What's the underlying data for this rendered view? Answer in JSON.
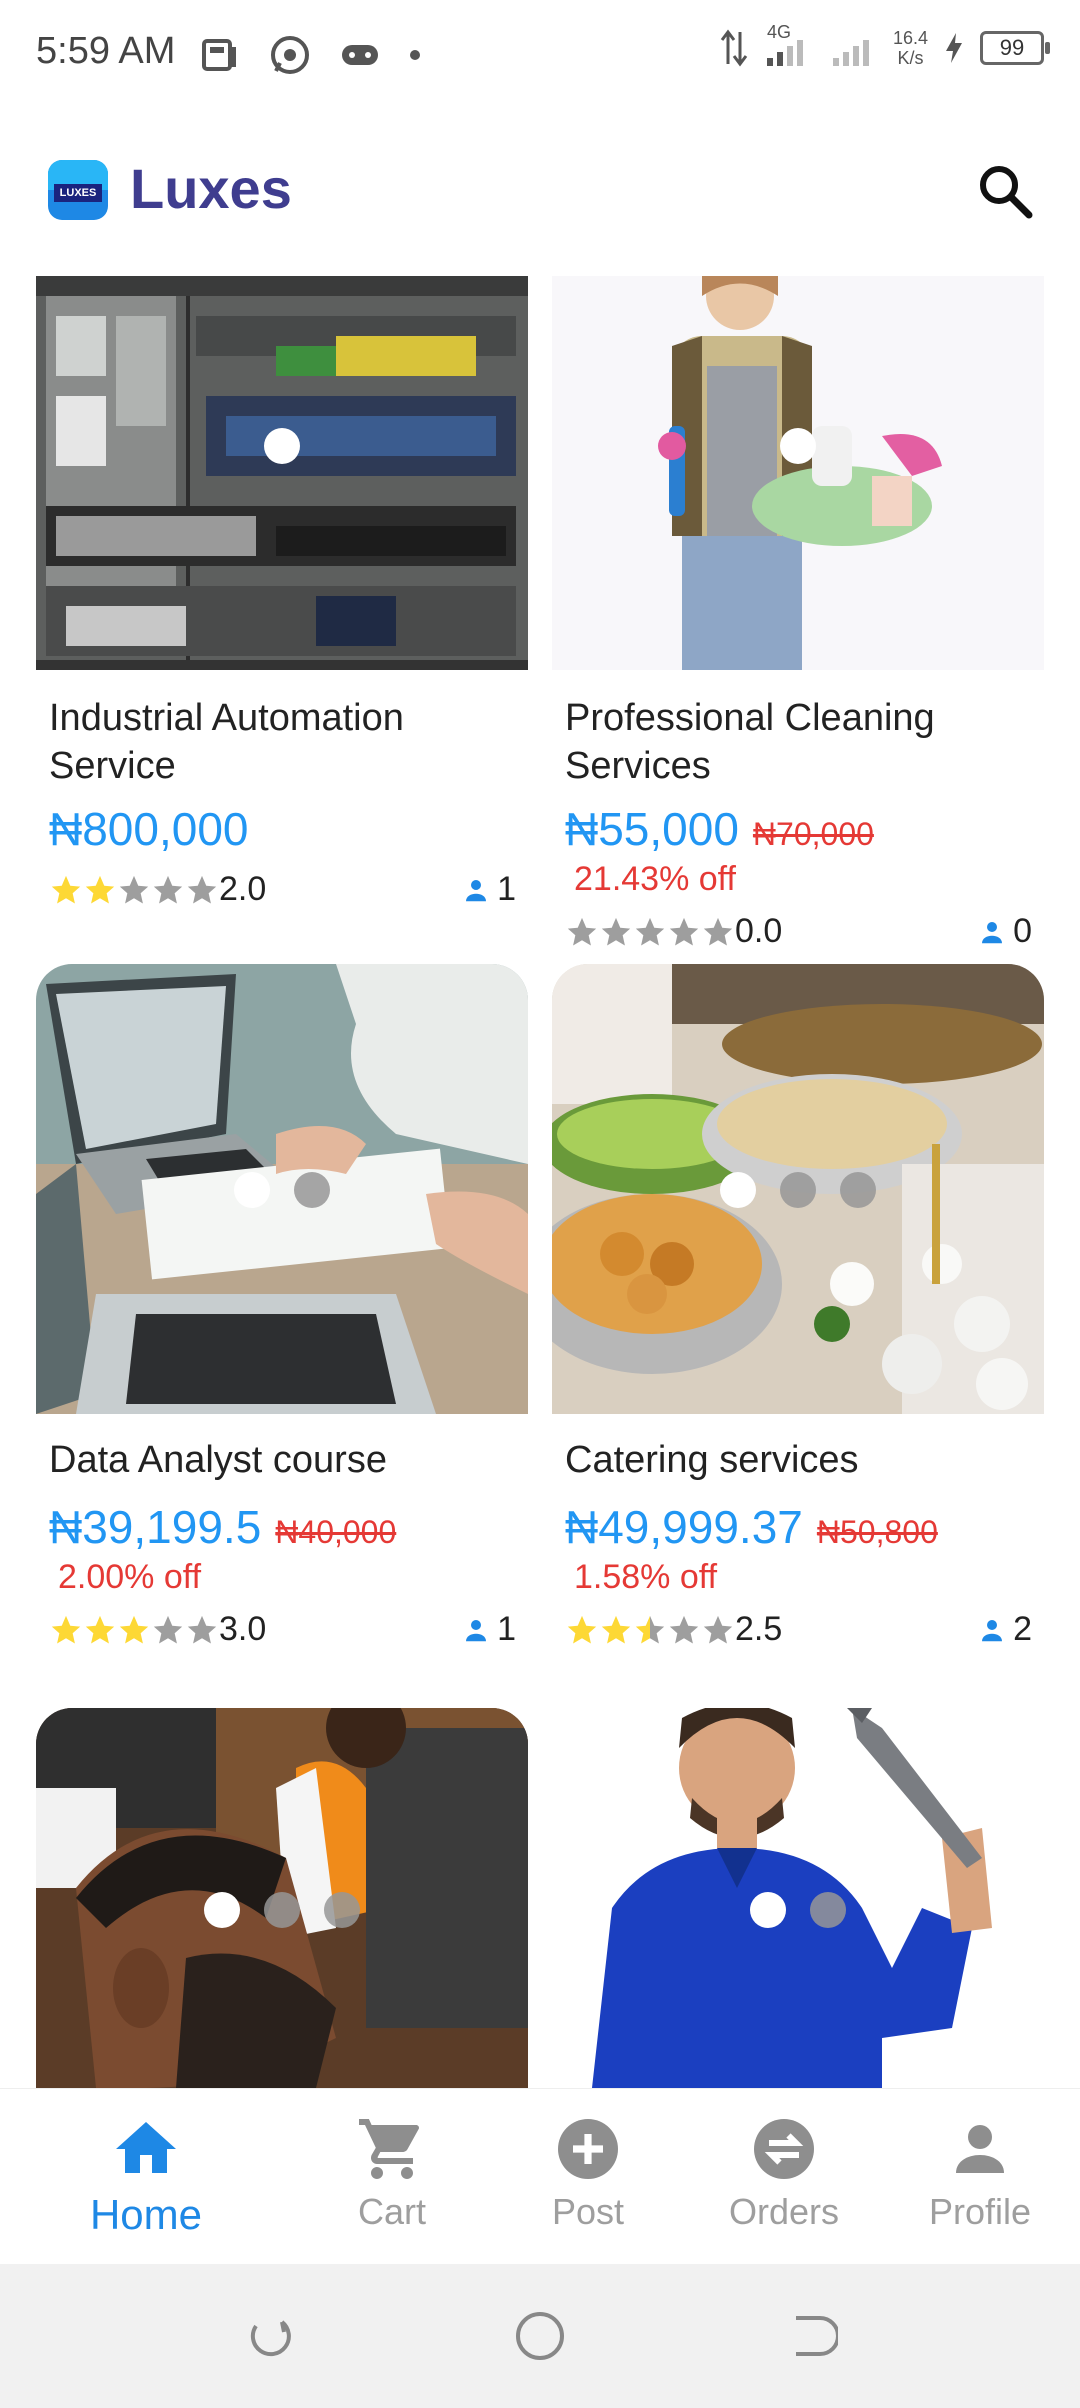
{
  "status_bar": {
    "time": "5:59 AM",
    "network": "4G",
    "speed_value": "16.4",
    "speed_unit": "K/s",
    "battery": "99"
  },
  "app_bar": {
    "brand": "Luxes",
    "logo_text": "LUXES"
  },
  "products": [
    {
      "title": "Industrial Automation Service",
      "price": "₦800,000",
      "rating": "2.0",
      "rating_value": 2.0,
      "buyers": "1",
      "image_dots": 1
    },
    {
      "title": "Professional Cleaning Services",
      "price": "₦55,000",
      "old_price": "₦70,000",
      "discount": "21.43% off",
      "rating": "0.0",
      "rating_value": 0.0,
      "buyers": "0",
      "image_dots": 1
    },
    {
      "title": "Data Analyst course",
      "price": "₦39,199.5",
      "old_price": "₦40,000",
      "discount": "2.00% off",
      "rating": "3.0",
      "rating_value": 3.0,
      "buyers": "1",
      "image_dots": 2
    },
    {
      "title": "Catering services",
      "price": "₦49,999.37",
      "old_price": "₦50,800",
      "discount": "1.58% off",
      "rating": "2.5",
      "rating_value": 2.5,
      "buyers": "2",
      "image_dots": 3
    },
    {
      "image_dots": 3
    },
    {
      "image_dots": 2
    }
  ],
  "bottom_nav": [
    {
      "label": "Home",
      "icon": "home-icon",
      "active": true
    },
    {
      "label": "Cart",
      "icon": "cart-icon"
    },
    {
      "label": "Post",
      "icon": "add-circle-icon"
    },
    {
      "label": "Orders",
      "icon": "swap-icon"
    },
    {
      "label": "Profile",
      "icon": "person-icon"
    }
  ],
  "colors": {
    "accent": "#2196f3",
    "brand": "#3f3d8f",
    "discount": "#e53935",
    "star": "#fdd835"
  }
}
